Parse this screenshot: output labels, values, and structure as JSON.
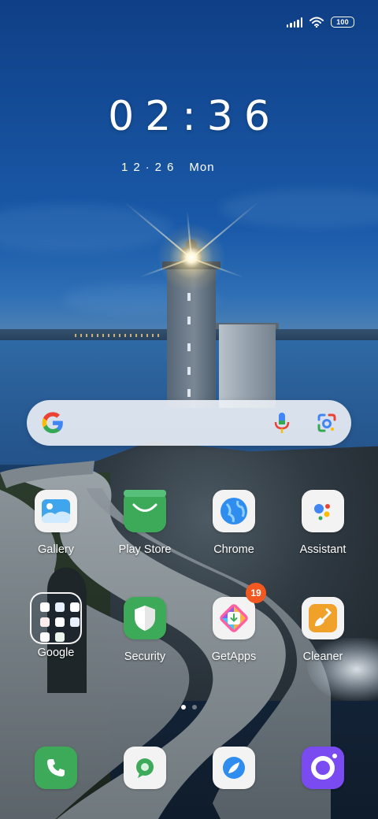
{
  "status_bar": {
    "battery": "100",
    "icons": [
      "signal-icon",
      "wifi-icon",
      "battery-icon"
    ]
  },
  "clock": {
    "time": "02:36"
  },
  "date": {
    "day_month": "12·26",
    "weekday": "Mon"
  },
  "search": {
    "icons": [
      "google-logo",
      "mic-icon",
      "lens-icon"
    ]
  },
  "apps_row1": [
    {
      "label": "Gallery",
      "icon": "gallery-icon"
    },
    {
      "label": "Play Store",
      "icon": "play-store-icon"
    },
    {
      "label": "Chrome",
      "icon": "chrome-icon"
    },
    {
      "label": "Assistant",
      "icon": "assistant-icon"
    }
  ],
  "apps_row2": [
    {
      "label": "Google",
      "icon": "google-folder"
    },
    {
      "label": "Security",
      "icon": "security-icon"
    },
    {
      "label": "GetApps",
      "icon": "getapps-icon",
      "badge": "19"
    },
    {
      "label": "Cleaner",
      "icon": "cleaner-icon"
    }
  ],
  "dock": [
    {
      "icon": "phone-icon"
    },
    {
      "icon": "messages-icon"
    },
    {
      "icon": "browser-icon"
    },
    {
      "icon": "camera-icon"
    }
  ],
  "page_indicator": {
    "pages": 2,
    "current": 1
  },
  "colors": {
    "badge": "#f2581f",
    "accent_green": "#3daa5a",
    "camera_purple": "#7a4bf0"
  }
}
